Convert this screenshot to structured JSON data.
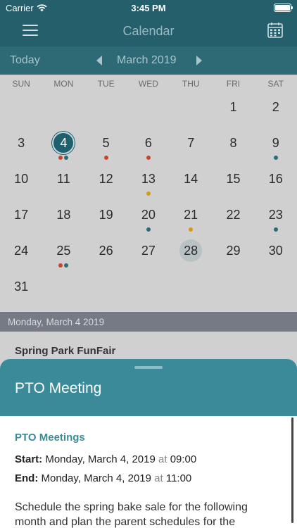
{
  "status": {
    "carrier": "Carrier",
    "time": "3:45 PM"
  },
  "nav": {
    "title": "Calendar",
    "menu_icon": "hamburger-icon",
    "calendar_icon": "calendar-icon"
  },
  "month_bar": {
    "today_label": "Today",
    "month_label": "March 2019"
  },
  "weekdays": [
    "SUN",
    "MON",
    "TUE",
    "WED",
    "THU",
    "FRI",
    "SAT"
  ],
  "colors": {
    "red": "#c8442e",
    "teal": "#2c6a78",
    "gold": "#d69a16",
    "selected": "#1f6070",
    "today": "#b8c2c4"
  },
  "weeks": [
    [
      null,
      null,
      null,
      null,
      null,
      {
        "day": "1",
        "dots": []
      },
      {
        "day": "2",
        "dots": []
      }
    ],
    [
      {
        "day": "3",
        "dots": []
      },
      {
        "day": "4",
        "dots": [
          "red",
          "teal"
        ],
        "state": "selected"
      },
      {
        "day": "5",
        "dots": [
          "red"
        ]
      },
      {
        "day": "6",
        "dots": [
          "red"
        ]
      },
      {
        "day": "7",
        "dots": []
      },
      {
        "day": "8",
        "dots": []
      },
      {
        "day": "9",
        "dots": [
          "teal"
        ]
      }
    ],
    [
      {
        "day": "10",
        "dots": []
      },
      {
        "day": "11",
        "dots": []
      },
      {
        "day": "12",
        "dots": []
      },
      {
        "day": "13",
        "dots": [
          "gold"
        ]
      },
      {
        "day": "14",
        "dots": []
      },
      {
        "day": "15",
        "dots": []
      },
      {
        "day": "16",
        "dots": []
      }
    ],
    [
      {
        "day": "17",
        "dots": []
      },
      {
        "day": "18",
        "dots": []
      },
      {
        "day": "19",
        "dots": []
      },
      {
        "day": "20",
        "dots": [
          "teal"
        ]
      },
      {
        "day": "21",
        "dots": [
          "gold"
        ]
      },
      {
        "day": "22",
        "dots": []
      },
      {
        "day": "23",
        "dots": [
          "teal"
        ]
      }
    ],
    [
      {
        "day": "24",
        "dots": []
      },
      {
        "day": "25",
        "dots": [
          "red",
          "teal"
        ]
      },
      {
        "day": "26",
        "dots": []
      },
      {
        "day": "27",
        "dots": []
      },
      {
        "day": "28",
        "dots": [],
        "state": "today"
      },
      {
        "day": "29",
        "dots": []
      },
      {
        "day": "30",
        "dots": []
      }
    ],
    [
      {
        "day": "31",
        "dots": []
      },
      null,
      null,
      null,
      null,
      null,
      null
    ]
  ],
  "selected_date_label": "Monday, March 4 2019",
  "event_list": {
    "first_event": "Spring Park FunFair"
  },
  "sheet": {
    "title": "PTO Meeting",
    "category": "PTO Meetings",
    "start_label": "Start:",
    "start_date": "Monday, March 4, 2019",
    "start_at": "at",
    "start_time": "09:00",
    "end_label": "End:",
    "end_date": "Monday, March 4, 2019",
    "end_at": "at",
    "end_time": "11:00",
    "description": "Schedule the spring bake sale for the following month and plan the parent schedules for the"
  }
}
